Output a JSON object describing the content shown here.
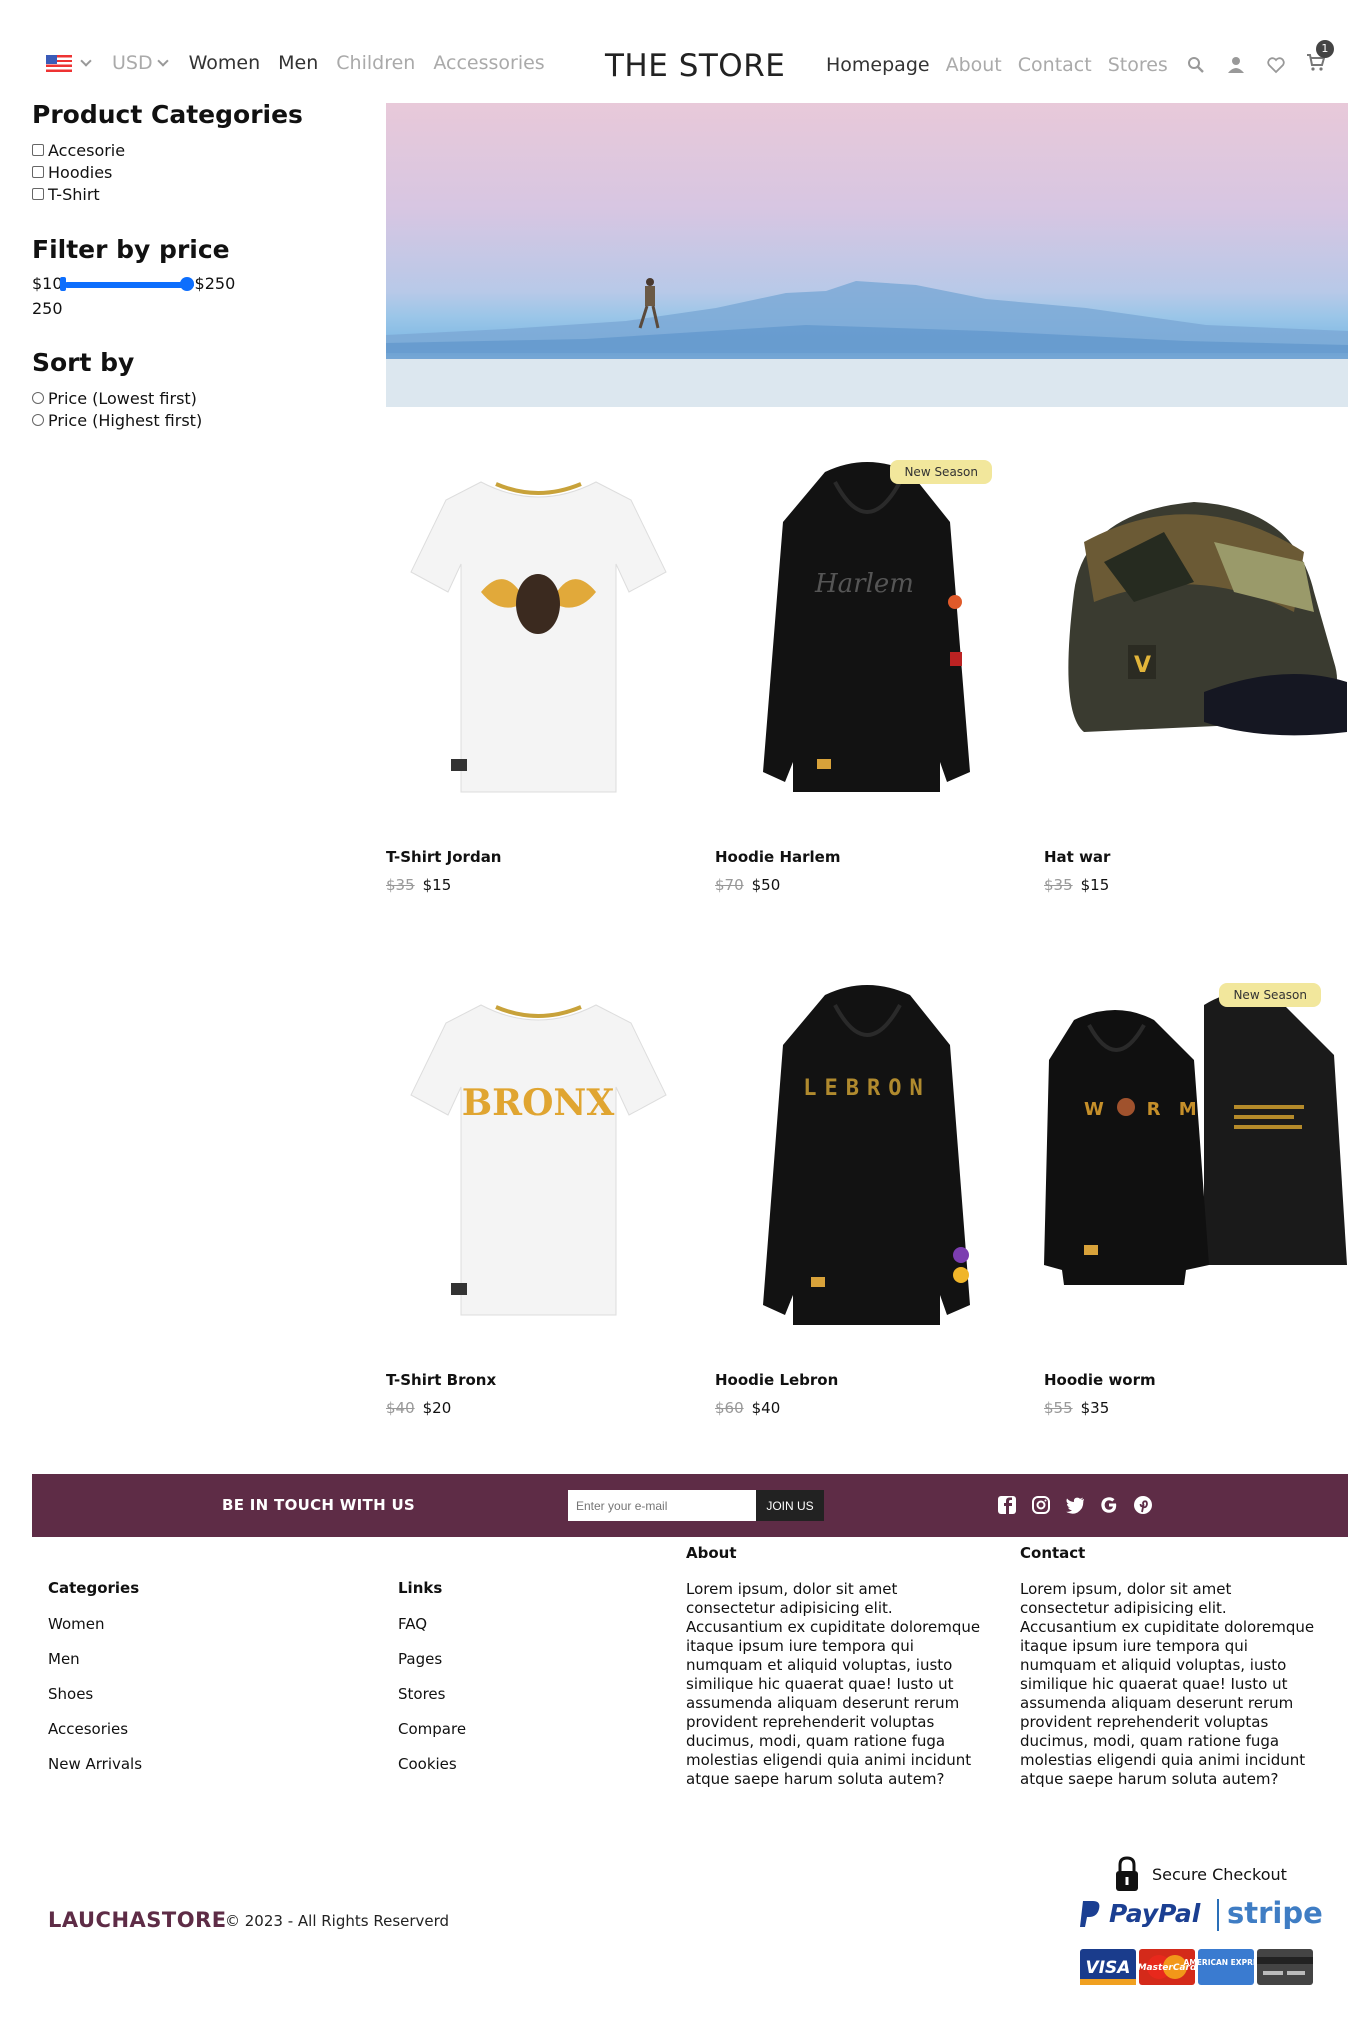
{
  "nav": {
    "currency": "USD",
    "left_links": [
      {
        "label": "Women",
        "active": true
      },
      {
        "label": "Men",
        "active": true
      },
      {
        "label": "Children",
        "active": false
      },
      {
        "label": "Accessories",
        "active": false
      }
    ],
    "brand": "THE STORE",
    "right_links": [
      {
        "label": "Homepage",
        "active": true
      },
      {
        "label": "About",
        "active": false
      },
      {
        "label": "Contact",
        "active": false
      },
      {
        "label": "Stores",
        "active": false
      }
    ],
    "cart_count": "1",
    "icons": [
      "flag-us-icon",
      "search-icon",
      "user-icon",
      "heart-icon",
      "cart-icon"
    ]
  },
  "sidebar": {
    "categories_title": "Product Categories",
    "categories": [
      "Accesorie",
      "Hoodies",
      "T-Shirt"
    ],
    "price_title": "Filter by price",
    "price_min": "$10",
    "price_max": "$250",
    "price_value": "250",
    "slider_fraction": 1.0,
    "sort_title": "Sort by",
    "sort_options": [
      "Price (Lowest first)",
      "Price (Highest first)"
    ]
  },
  "products": [
    {
      "name": "T-Shirt Jordan",
      "old_price": "$35",
      "price": "$15",
      "tag": "",
      "kind": "tshirt-face"
    },
    {
      "name": "Hoodie Harlem",
      "old_price": "$70",
      "price": "$50",
      "tag": "New Season",
      "kind": "hoodie-harlem"
    },
    {
      "name": "Hat war",
      "old_price": "$35",
      "price": "$15",
      "tag": "",
      "kind": "cap"
    },
    {
      "name": "T-Shirt Bronx",
      "old_price": "$40",
      "price": "$20",
      "tag": "",
      "kind": "tshirt-bronx"
    },
    {
      "name": "Hoodie Lebron",
      "old_price": "$60",
      "price": "$40",
      "tag": "",
      "kind": "hoodie-lebron"
    },
    {
      "name": "Hoodie worm",
      "old_price": "$55",
      "price": "$35",
      "tag": "New Season",
      "kind": "hoodie-worm"
    }
  ],
  "product_print": {
    "bronx": "BRONX",
    "lebron": "LEBRON",
    "worm": "W   R M",
    "harlem": "Harlem",
    "cap_logo": "V"
  },
  "newsletter": {
    "title": "BE IN TOUCH WITH US",
    "placeholder": "Enter your e-mail",
    "button": "JOIN US",
    "social_icons": [
      "facebook-icon",
      "instagram-icon",
      "twitter-icon",
      "google-icon",
      "pinterest-icon"
    ]
  },
  "footer": {
    "categories_title": "Categories",
    "categories": [
      "Women",
      "Men",
      "Shoes",
      "Accesories",
      "New Arrivals"
    ],
    "links_title": "Links",
    "links": [
      "FAQ",
      "Pages",
      "Stores",
      "Compare",
      "Cookies"
    ],
    "about_title": "About",
    "about_text": "Lorem ipsum, dolor sit amet consectetur adipisicing elit. Accusantium ex cupiditate doloremque itaque ipsum iure tempora qui numquam et aliquid voluptas, iusto similique hic quaerat quae! Iusto ut assumenda aliquam deserunt rerum provident reprehenderit voluptas ducimus, modi, quam ratione fuga molestias eligendi quia animi incidunt atque saepe harum soluta autem?",
    "contact_title": "Contact",
    "contact_text": "Lorem ipsum, dolor sit amet consectetur adipisicing elit. Accusantium ex cupiditate doloremque itaque ipsum iure tempora qui numquam et aliquid voluptas, iusto similique hic quaerat quae! Iusto ut assumenda aliquam deserunt rerum provident reprehenderit voluptas ducimus, modi, quam ratione fuga molestias eligendi quia animi incidunt atque saepe harum soluta autem?",
    "brand": "LAUCHASTORE",
    "copyright": "© 2023 - All Rights Reserverd",
    "secure_label": "Secure Checkout",
    "paypal": "PayPal",
    "stripe": "stripe",
    "cards": [
      "VISA",
      "MasterCard",
      "AMERICAN EXPRESS"
    ]
  },
  "colors": {
    "accent": "#5e2c46",
    "slider": "#0d6efd",
    "tag": "#f2e79c"
  }
}
